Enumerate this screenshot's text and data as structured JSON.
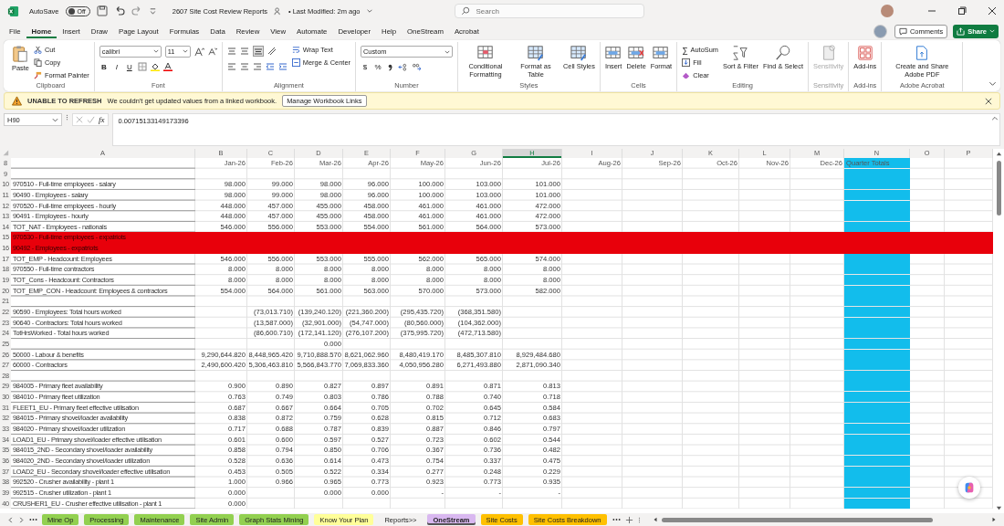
{
  "title_bar": {
    "autosave_label": "AutoSave",
    "autosave": {
      "on": false,
      "text": "Off"
    },
    "file_name": "2607 Site Cost Review Reports",
    "modified": "• Last Modified: 2m ago",
    "search": {
      "placeholder": "Search"
    }
  },
  "menu": [
    {
      "label": "File",
      "selected": false
    },
    {
      "label": "Home",
      "selected": true
    },
    {
      "label": "Insert",
      "selected": false
    },
    {
      "label": "Draw",
      "selected": false
    },
    {
      "label": "Page Layout",
      "selected": false
    },
    {
      "label": "Formulas",
      "selected": false
    },
    {
      "label": "Data",
      "selected": false
    },
    {
      "label": "Review",
      "selected": false
    },
    {
      "label": "View",
      "selected": false
    },
    {
      "label": "Automate",
      "selected": false
    },
    {
      "label": "Developer",
      "selected": false
    },
    {
      "label": "Help",
      "selected": false
    },
    {
      "label": "OneStream",
      "selected": false
    },
    {
      "label": "Acrobat",
      "selected": false
    }
  ],
  "comments_button": "Comments",
  "share_button": "Share",
  "ribbon": {
    "groups": [
      {
        "kind": "clipboard",
        "label": "Clipboard",
        "disabled": false,
        "buttons": [
          "Paste",
          "Cut",
          "Copy",
          "Format Painter"
        ]
      },
      {
        "kind": "font",
        "label": "Font",
        "disabled": false,
        "font": "calibri",
        "size": "11",
        "buttons": [
          "B",
          "I",
          "U"
        ]
      },
      {
        "kind": "alignment",
        "label": "Alignment",
        "disabled": false,
        "buttons": [
          "Wrap Text",
          "Merge & Center"
        ]
      },
      {
        "kind": "number",
        "label": "Number",
        "disabled": false,
        "format": "Custom",
        "buttons": [
          "$",
          "%"
        ]
      },
      {
        "kind": "styles",
        "label": "Styles",
        "disabled": false,
        "buttons": [
          "Conditional Formatting",
          "Format as Table",
          "Cell Styles"
        ]
      },
      {
        "kind": "cells",
        "label": "Cells",
        "disabled": false,
        "buttons": [
          "Insert",
          "Delete",
          "Format"
        ]
      },
      {
        "kind": "editing",
        "label": "Editing",
        "disabled": false,
        "symbol": "∑",
        "buttons": [
          "AutoSum",
          "Fill",
          "Clear",
          "Sort & Filter",
          "Find & Select"
        ]
      },
      {
        "kind": "sensitivity",
        "label": "Sensitivity",
        "disabled": true,
        "buttons": [
          "Sensitivity"
        ]
      },
      {
        "kind": "addins",
        "label": "Add-ins",
        "disabled": false,
        "buttons": [
          "Add-ins"
        ]
      },
      {
        "kind": "acrobat",
        "label": "Adobe Acrobat",
        "disabled": false,
        "buttons": [
          "Create and Share Adobe PDF"
        ]
      }
    ]
  },
  "warning": {
    "title": "UNABLE TO REFRESH",
    "message": "We couldn't get updated values from a linked workbook.",
    "button": "Manage Workbook Links"
  },
  "formula_bar": {
    "name_box": "H90",
    "function_button": "fx",
    "value": "0.00715133149173396"
  },
  "columns": [
    {
      "label": "A",
      "selected": false
    },
    {
      "label": "B",
      "selected": false
    },
    {
      "label": "C",
      "selected": false
    },
    {
      "label": "D",
      "selected": false
    },
    {
      "label": "E",
      "selected": false
    },
    {
      "label": "F",
      "selected": false
    },
    {
      "label": "G",
      "selected": false
    },
    {
      "label": "H",
      "selected": true
    },
    {
      "label": "I",
      "selected": false
    },
    {
      "label": "J",
      "selected": false
    },
    {
      "label": "K",
      "selected": false
    },
    {
      "label": "L",
      "selected": false
    },
    {
      "label": "M",
      "selected": false
    },
    {
      "label": "N",
      "selected": false,
      "color": "#12bdec"
    },
    {
      "label": "O",
      "selected": false
    },
    {
      "label": "P",
      "selected": false
    }
  ],
  "rows": [
    {
      "num": "8",
      "values": [
        "Jan-26",
        "Feb-26",
        "Mar-26",
        "Apr-26",
        "May-26",
        "Jun-26",
        "Jul-26",
        "Aug-26",
        "Sep-26",
        "Oct-26",
        "Nov-26",
        "Dec-26",
        "Quarter Totals"
      ]
    },
    {
      "num": "9"
    },
    {
      "num": "10",
      "label": "970510 - Full-time employees - salary",
      "values": [
        "98.000",
        "99.000",
        "98.000",
        "96.000",
        "100.000",
        "103.000",
        "101.000"
      ]
    },
    {
      "num": "11",
      "label": "90490 - Employees - salary",
      "values": [
        "98.000",
        "99.000",
        "98.000",
        "96.000",
        "100.000",
        "103.000",
        "101.000"
      ]
    },
    {
      "num": "12",
      "label": "970520 - Full-time employees - hourly",
      "values": [
        "448.000",
        "457.000",
        "455.000",
        "458.000",
        "461.000",
        "461.000",
        "472.000"
      ]
    },
    {
      "num": "13",
      "label": "90491 - Employees - hourly",
      "values": [
        "448.000",
        "457.000",
        "455.000",
        "458.000",
        "461.000",
        "461.000",
        "472.000"
      ]
    },
    {
      "num": "14",
      "label": "TOT_NAT - Employees - nationals",
      "values": [
        "546.000",
        "556.000",
        "553.000",
        "554.000",
        "561.000",
        "564.000",
        "573.000"
      ]
    },
    {
      "num": "15",
      "label": "970530 - Full-time employees - expatriots",
      "color": "#e8000b"
    },
    {
      "num": "16",
      "label": "90492 - Employees - expatriots",
      "color": "#e8000b"
    },
    {
      "num": "17",
      "label": "TOT_EMP - Headcount: Employees",
      "values": [
        "546.000",
        "556.000",
        "553.000",
        "555.000",
        "562.000",
        "565.000",
        "574.000"
      ]
    },
    {
      "num": "18",
      "label": "970550 - Full-time contractors",
      "values": [
        "8.000",
        "8.000",
        "8.000",
        "8.000",
        "8.000",
        "8.000",
        "8.000"
      ]
    },
    {
      "num": "19",
      "label": "TOT_Cons - Headcount: Contractors",
      "values": [
        "8.000",
        "8.000",
        "8.000",
        "8.000",
        "8.000",
        "8.000",
        "8.000"
      ]
    },
    {
      "num": "20",
      "label": "TOT_EMP_CON - Headcount: Employees & contractors",
      "values": [
        "554.000",
        "564.000",
        "561.000",
        "563.000",
        "570.000",
        "573.000",
        "582.000"
      ]
    },
    {
      "num": "21"
    },
    {
      "num": "22",
      "label": "90590 - Employees: Total hours worked",
      "cells": [
        {
          "kind": "empty"
        },
        {
          "kind": "value",
          "text": "(73,013.710)"
        },
        {
          "kind": "value",
          "text": "(139,240.120)"
        },
        {
          "kind": "value",
          "text": "(221,360.200)"
        },
        {
          "kind": "value",
          "text": "(295,435.720)"
        },
        {
          "kind": "value",
          "text": "(368,351.580)"
        }
      ]
    },
    {
      "num": "23",
      "label": "90640 - Contractors: Total hours worked",
      "cells": [
        {
          "kind": "empty"
        },
        {
          "kind": "value",
          "text": "(13,587.000)"
        },
        {
          "kind": "value",
          "text": "(32,901.000)"
        },
        {
          "kind": "value",
          "text": "(54,747.000)"
        },
        {
          "kind": "value",
          "text": "(80,560.000)"
        },
        {
          "kind": "value",
          "text": "(104,362.000)"
        }
      ]
    },
    {
      "num": "24",
      "label": "TotHrsWorked - Total hours worked",
      "cells": [
        {
          "kind": "empty"
        },
        {
          "kind": "value",
          "text": "(86,600.710)"
        },
        {
          "kind": "value",
          "text": "(172,141.120)"
        },
        {
          "kind": "value",
          "text": "(276,107.200)"
        },
        {
          "kind": "value",
          "text": "(375,995.720)"
        },
        {
          "kind": "value",
          "text": "(472,713.580)"
        }
      ]
    },
    {
      "num": "25",
      "cells": [
        {
          "kind": "empty"
        },
        {
          "kind": "empty"
        },
        {
          "kind": "value",
          "text": "0.000"
        }
      ]
    },
    {
      "num": "26",
      "label": "50000 - Labour & benefits",
      "values": [
        "9,290,644.820",
        "8,448,965.420",
        "9,710,888.570",
        "8,621,062.960",
        "8,480,419.170",
        "8,485,307.810",
        "8,929,484.680"
      ]
    },
    {
      "num": "27",
      "label": "60000 - Contractors",
      "values": [
        "2,490,600.420",
        "5,306,463.810",
        "5,566,843.770",
        "7,069,833.360",
        "4,050,956.280",
        "6,271,493.880",
        "2,871,090.340"
      ]
    },
    {
      "num": "28"
    },
    {
      "num": "29",
      "label": "984005 - Primary fleet availability",
      "values": [
        "0.900",
        "0.890",
        "0.827",
        "0.897",
        "0.891",
        "0.871",
        "0.813"
      ]
    },
    {
      "num": "30",
      "label": "984010 - Primary fleet utilization",
      "values": [
        "0.763",
        "0.749",
        "0.803",
        "0.786",
        "0.788",
        "0.740",
        "0.718"
      ]
    },
    {
      "num": "31",
      "label": "FLEET1_EU - Primary fleet effective utilisation",
      "values": [
        "0.687",
        "0.667",
        "0.664",
        "0.705",
        "0.702",
        "0.645",
        "0.584"
      ]
    },
    {
      "num": "32",
      "label": "984015 - Primary shovel/loader availability",
      "values": [
        "0.838",
        "0.872",
        "0.759",
        "0.628",
        "0.815",
        "0.712",
        "0.683"
      ]
    },
    {
      "num": "33",
      "label": "984020 - Primary shovel/loader utilization",
      "values": [
        "0.717",
        "0.688",
        "0.787",
        "0.839",
        "0.887",
        "0.846",
        "0.797"
      ]
    },
    {
      "num": "34",
      "label": "LOAD1_EU - Primary shovel/loader effective utilisation",
      "values": [
        "0.601",
        "0.600",
        "0.597",
        "0.527",
        "0.723",
        "0.602",
        "0.544"
      ]
    },
    {
      "num": "35",
      "label": "984015_2ND - Secondary shovel/loader availability",
      "values": [
        "0.858",
        "0.794",
        "0.850",
        "0.706",
        "0.367",
        "0.736",
        "0.482"
      ]
    },
    {
      "num": "36",
      "label": "984020_2ND - Secondary shovel/loader utilization",
      "values": [
        "0.528",
        "0.636",
        "0.614",
        "0.473",
        "0.754",
        "0.337",
        "0.475"
      ]
    },
    {
      "num": "37",
      "label": "LOAD2_EU - Secondary shovel/loader effective utilisation",
      "values": [
        "0.453",
        "0.505",
        "0.522",
        "0.334",
        "0.277",
        "0.248",
        "0.229"
      ]
    },
    {
      "num": "38",
      "label": "992520 - Crusher availability - plant 1",
      "values": [
        "1.000",
        "0.966",
        "0.965",
        "0.773",
        "0.923",
        "0.773",
        "0.935"
      ]
    },
    {
      "num": "39",
      "label": "992515 - Crusher utilization - plant 1",
      "cells": [
        {
          "kind": "value",
          "text": "0.000"
        },
        {
          "kind": "empty"
        },
        {
          "kind": "value",
          "text": "0.000"
        },
        {
          "kind": "value",
          "text": "0.000"
        },
        {
          "kind": "value",
          "text": "-"
        },
        {
          "kind": "value",
          "text": "-"
        },
        {
          "kind": "value",
          "text": "-"
        }
      ]
    },
    {
      "num": "40",
      "label": "CRUSHER1_EU - Crusher effective utilisation - plant 1",
      "values": [
        "0.000"
      ]
    }
  ],
  "sheet_tabs": [
    {
      "label": "Mine Op",
      "selected": false,
      "color": "#92d050"
    },
    {
      "label": "Processing",
      "selected": false,
      "color": "#92d050"
    },
    {
      "label": "Maintenance",
      "selected": false,
      "color": "#92d050"
    },
    {
      "label": "Site Admin",
      "selected": false,
      "color": "#92d050"
    },
    {
      "label": "Graph Stats Mining",
      "selected": false,
      "color": "#92d050"
    },
    {
      "label": "Know Your Plan",
      "selected": false,
      "color": "#ffff99"
    },
    {
      "label": "Reports>>",
      "selected": false
    },
    {
      "label": "OneStream",
      "selected": true,
      "color": "#d9b8f0"
    },
    {
      "label": "Site Costs",
      "selected": false,
      "color": "#ffc000"
    },
    {
      "label": "Site Costs Breakdown",
      "selected": false,
      "color": "#ffc000"
    }
  ]
}
